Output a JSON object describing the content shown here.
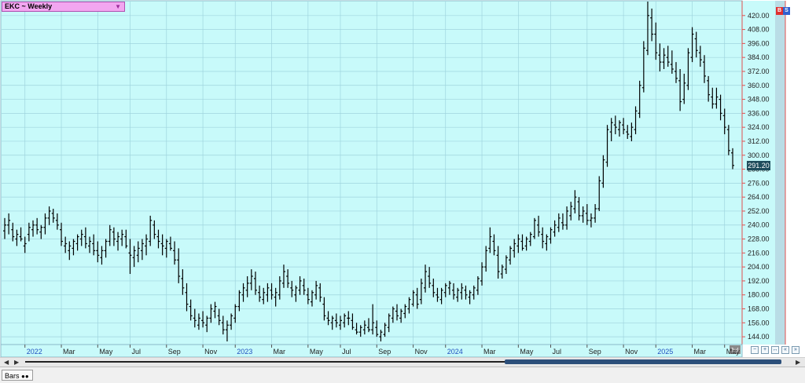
{
  "header": {
    "symbol_label": "EKC ~ Weekly",
    "dropdown_icon": "triangle-down-icon"
  },
  "last_price_label": "291.20",
  "tabs": {
    "bars_label": "Bars",
    "bars_icon": "binoculars-icon"
  },
  "scale_badges": [
    "B",
    "S"
  ],
  "colors": {
    "plot_bg": "#c8fafa",
    "grid": "#9fd4de",
    "bar": "#000000",
    "accent_line": "#e05050",
    "price_tag": "#1f4d5c"
  },
  "chart_data": {
    "type": "ohlc-bar",
    "title": "EKC ~ Weekly",
    "xlabel": "",
    "ylabel": "",
    "ylim": [
      138,
      432
    ],
    "y_ticks": [
      144,
      156,
      168,
      180,
      192,
      204,
      216,
      228,
      240,
      252,
      264,
      276,
      288,
      300,
      312,
      324,
      336,
      348,
      360,
      372,
      384,
      396,
      408,
      420
    ],
    "y_tick_labels": [
      "144.00",
      "156.00",
      "168.00",
      "180.00",
      "192.00",
      "204.00",
      "216.00",
      "228.00",
      "240.00",
      "252.00",
      "264.00",
      "276.00",
      "288.00",
      "300.00",
      "312.00",
      "324.00",
      "336.00",
      "348.00",
      "360.00",
      "372.00",
      "384.00",
      "396.00",
      "408.00",
      "420.00"
    ],
    "x_labels": [
      {
        "label": "2022",
        "week": 5,
        "year_marker": true
      },
      {
        "label": "Mar",
        "week": 14
      },
      {
        "label": "May",
        "week": 23
      },
      {
        "label": "Jul",
        "week": 31
      },
      {
        "label": "Sep",
        "week": 40
      },
      {
        "label": "Nov",
        "week": 49
      },
      {
        "label": "2023",
        "week": 57,
        "year_marker": true
      },
      {
        "label": "Mar",
        "week": 66
      },
      {
        "label": "May",
        "week": 75
      },
      {
        "label": "Jul",
        "week": 83
      },
      {
        "label": "Sep",
        "week": 92
      },
      {
        "label": "Nov",
        "week": 101
      },
      {
        "label": "2024",
        "week": 109,
        "year_marker": true
      },
      {
        "label": "Mar",
        "week": 118
      },
      {
        "label": "May",
        "week": 127
      },
      {
        "label": "Jul",
        "week": 135
      },
      {
        "label": "Sep",
        "week": 144
      },
      {
        "label": "Nov",
        "week": 153
      },
      {
        "label": "2025",
        "week": 161,
        "year_marker": true
      },
      {
        "label": "Mar",
        "week": 170
      },
      {
        "label": "May",
        "week": 178
      }
    ],
    "last_price": 291.2,
    "series": [
      {
        "values": [
          [
            235,
            246,
            228,
            240
          ],
          [
            240,
            250,
            232,
            244
          ],
          [
            236,
            242,
            226,
            230
          ],
          [
            228,
            236,
            222,
            232
          ],
          [
            230,
            238,
            226,
            228
          ],
          [
            222,
            230,
            216,
            224
          ],
          [
            232,
            242,
            226,
            238
          ],
          [
            236,
            244,
            230,
            240
          ],
          [
            240,
            246,
            232,
            236
          ],
          [
            234,
            240,
            228,
            238
          ],
          [
            238,
            250,
            232,
            246
          ],
          [
            246,
            256,
            240,
            252
          ],
          [
            250,
            254,
            242,
            246
          ],
          [
            244,
            250,
            236,
            240
          ],
          [
            236,
            242,
            222,
            226
          ],
          [
            222,
            230,
            216,
            224
          ],
          [
            218,
            226,
            210,
            222
          ],
          [
            220,
            228,
            214,
            226
          ],
          [
            224,
            232,
            218,
            230
          ],
          [
            228,
            236,
            222,
            232
          ],
          [
            230,
            238,
            220,
            224
          ],
          [
            222,
            230,
            216,
            226
          ],
          [
            224,
            232,
            214,
            218
          ],
          [
            218,
            226,
            208,
            214
          ],
          [
            212,
            222,
            206,
            218
          ],
          [
            218,
            228,
            212,
            226
          ],
          [
            226,
            240,
            222,
            236
          ],
          [
            234,
            238,
            222,
            228
          ],
          [
            226,
            234,
            218,
            230
          ],
          [
            228,
            236,
            222,
            232
          ],
          [
            230,
            236,
            220,
            222
          ],
          [
            216,
            228,
            198,
            214
          ],
          [
            212,
            222,
            204,
            218
          ],
          [
            214,
            226,
            208,
            220
          ],
          [
            218,
            228,
            210,
            224
          ],
          [
            222,
            232,
            214,
            228
          ],
          [
            226,
            248,
            222,
            244
          ],
          [
            240,
            244,
            228,
            232
          ],
          [
            230,
            236,
            220,
            226
          ],
          [
            224,
            232,
            214,
            222
          ],
          [
            220,
            228,
            212,
            226
          ],
          [
            224,
            230,
            218,
            220
          ],
          [
            218,
            226,
            206,
            210
          ],
          [
            210,
            220,
            190,
            196
          ],
          [
            194,
            202,
            180,
            186
          ],
          [
            182,
            190,
            166,
            172
          ],
          [
            170,
            176,
            158,
            162
          ],
          [
            160,
            168,
            152,
            158
          ],
          [
            154,
            164,
            150,
            160
          ],
          [
            158,
            166,
            152,
            156
          ],
          [
            154,
            162,
            148,
            160
          ],
          [
            160,
            172,
            156,
            168
          ],
          [
            166,
            174,
            160,
            170
          ],
          [
            162,
            168,
            154,
            158
          ],
          [
            156,
            162,
            146,
            150
          ],
          [
            150,
            158,
            140,
            154
          ],
          [
            154,
            164,
            150,
            162
          ],
          [
            160,
            172,
            156,
            170
          ],
          [
            170,
            184,
            166,
            182
          ],
          [
            180,
            190,
            174,
            186
          ],
          [
            184,
            196,
            178,
            190
          ],
          [
            190,
            202,
            184,
            196
          ],
          [
            194,
            200,
            180,
            184
          ],
          [
            182,
            188,
            174,
            178
          ],
          [
            176,
            186,
            172,
            182
          ],
          [
            180,
            190,
            174,
            186
          ],
          [
            184,
            190,
            176,
            180
          ],
          [
            178,
            186,
            170,
            182
          ],
          [
            180,
            196,
            176,
            192
          ],
          [
            190,
            206,
            186,
            200
          ],
          [
            196,
            202,
            186,
            190
          ],
          [
            186,
            192,
            178,
            184
          ],
          [
            180,
            188,
            174,
            186
          ],
          [
            184,
            196,
            180,
            192
          ],
          [
            188,
            194,
            180,
            184
          ],
          [
            180,
            186,
            172,
            176
          ],
          [
            174,
            184,
            170,
            182
          ],
          [
            180,
            192,
            176,
            188
          ],
          [
            186,
            190,
            174,
            178
          ],
          [
            172,
            178,
            158,
            162
          ],
          [
            160,
            166,
            154,
            158
          ],
          [
            156,
            162,
            150,
            160
          ],
          [
            158,
            164,
            152,
            156
          ],
          [
            154,
            162,
            150,
            158
          ],
          [
            156,
            164,
            152,
            162
          ],
          [
            160,
            166,
            154,
            160
          ],
          [
            158,
            164,
            150,
            152
          ],
          [
            150,
            156,
            146,
            148
          ],
          [
            148,
            154,
            144,
            152
          ],
          [
            150,
            158,
            146,
            154
          ],
          [
            152,
            160,
            148,
            150
          ],
          [
            150,
            172,
            146,
            156
          ],
          [
            152,
            158,
            144,
            146
          ],
          [
            144,
            150,
            140,
            148
          ],
          [
            146,
            156,
            144,
            154
          ],
          [
            152,
            164,
            148,
            162
          ],
          [
            160,
            170,
            156,
            168
          ],
          [
            166,
            172,
            158,
            162
          ],
          [
            160,
            168,
            156,
            166
          ],
          [
            164,
            172,
            160,
            170
          ],
          [
            168,
            178,
            164,
            176
          ],
          [
            172,
            184,
            170,
            182
          ],
          [
            180,
            186,
            168,
            172
          ],
          [
            176,
            194,
            172,
            190
          ],
          [
            186,
            206,
            182,
            200
          ],
          [
            196,
            204,
            186,
            190
          ],
          [
            188,
            194,
            178,
            182
          ],
          [
            180,
            186,
            174,
            178
          ],
          [
            176,
            186,
            172,
            184
          ],
          [
            182,
            190,
            178,
            188
          ],
          [
            186,
            192,
            180,
            190
          ],
          [
            184,
            190,
            176,
            180
          ],
          [
            178,
            186,
            174,
            184
          ],
          [
            182,
            190,
            176,
            186
          ],
          [
            184,
            188,
            176,
            180
          ],
          [
            178,
            184,
            172,
            182
          ],
          [
            180,
            188,
            176,
            186
          ],
          [
            184,
            196,
            180,
            194
          ],
          [
            192,
            208,
            188,
            204
          ],
          [
            204,
            222,
            200,
            218
          ],
          [
            220,
            238,
            216,
            230
          ],
          [
            226,
            232,
            214,
            218
          ],
          [
            214,
            222,
            194,
            200
          ],
          [
            198,
            206,
            194,
            204
          ],
          [
            202,
            214,
            198,
            212
          ],
          [
            210,
            222,
            206,
            220
          ],
          [
            218,
            228,
            212,
            224
          ],
          [
            222,
            232,
            216,
            228
          ],
          [
            226,
            232,
            218,
            220
          ],
          [
            222,
            230,
            218,
            228
          ],
          [
            226,
            234,
            222,
            232
          ],
          [
            230,
            246,
            228,
            244
          ],
          [
            240,
            248,
            230,
            234
          ],
          [
            232,
            238,
            220,
            226
          ],
          [
            224,
            232,
            218,
            230
          ],
          [
            228,
            238,
            224,
            236
          ],
          [
            234,
            244,
            230,
            240
          ],
          [
            238,
            250,
            234,
            246
          ],
          [
            242,
            250,
            236,
            240
          ],
          [
            240,
            256,
            236,
            252
          ],
          [
            248,
            260,
            244,
            256
          ],
          [
            254,
            270,
            250,
            264
          ],
          [
            260,
            264,
            244,
            248
          ],
          [
            248,
            256,
            242,
            252
          ],
          [
            250,
            258,
            240,
            244
          ],
          [
            244,
            250,
            238,
            246
          ],
          [
            246,
            258,
            242,
            254
          ],
          [
            254,
            282,
            252,
            278
          ],
          [
            276,
            300,
            272,
            296
          ],
          [
            294,
            326,
            290,
            322
          ],
          [
            320,
            332,
            312,
            328
          ],
          [
            326,
            334,
            318,
            324
          ],
          [
            322,
            330,
            316,
            328
          ],
          [
            326,
            332,
            318,
            322
          ],
          [
            320,
            326,
            314,
            318
          ],
          [
            316,
            328,
            312,
            324
          ],
          [
            322,
            342,
            318,
            338
          ],
          [
            336,
            364,
            332,
            360
          ],
          [
            358,
            398,
            354,
            392
          ],
          [
            390,
            432,
            386,
            420
          ],
          [
            418,
            426,
            398,
            404
          ],
          [
            404,
            414,
            382,
            388
          ],
          [
            386,
            396,
            372,
            380
          ],
          [
            380,
            392,
            374,
            386
          ],
          [
            384,
            394,
            376,
            380
          ],
          [
            378,
            390,
            370,
            374
          ],
          [
            372,
            380,
            362,
            366
          ],
          [
            364,
            374,
            338,
            346
          ],
          [
            348,
            370,
            344,
            362
          ],
          [
            360,
            392,
            356,
            388
          ],
          [
            384,
            410,
            380,
            404
          ],
          [
            400,
            406,
            384,
            390
          ],
          [
            388,
            394,
            376,
            382
          ],
          [
            380,
            386,
            362,
            368
          ],
          [
            364,
            368,
            346,
            352
          ],
          [
            350,
            358,
            340,
            344
          ],
          [
            344,
            358,
            340,
            350
          ],
          [
            348,
            352,
            330,
            336
          ],
          [
            334,
            340,
            318,
            324
          ],
          [
            322,
            326,
            300,
            304
          ],
          [
            302,
            306,
            288,
            291.2
          ]
        ]
      }
    ]
  }
}
